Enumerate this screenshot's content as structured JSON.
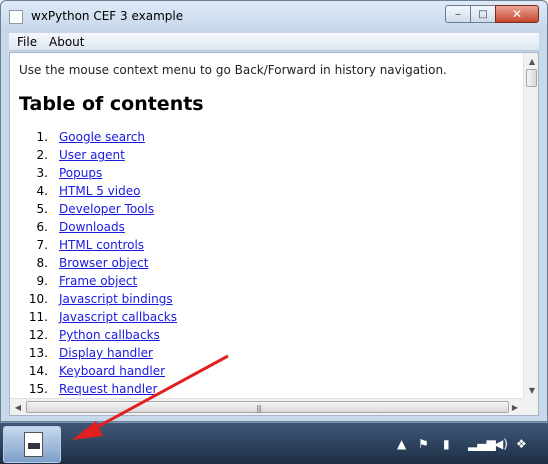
{
  "window": {
    "title": "wxPython CEF 3 example",
    "minimize_glyph": "‒",
    "maximize_glyph": "□",
    "close_glyph": "✕"
  },
  "menu": {
    "items": [
      {
        "label": "File"
      },
      {
        "label": "About"
      }
    ]
  },
  "page": {
    "intro": "Use the mouse context menu to go Back/Forward in history navigation.",
    "heading": "Table of contents",
    "toc": [
      {
        "num": "1.",
        "label": "Google search"
      },
      {
        "num": "2.",
        "label": "User agent"
      },
      {
        "num": "3.",
        "label": "Popups"
      },
      {
        "num": "4.",
        "label": "HTML 5 video"
      },
      {
        "num": "5.",
        "label": "Developer Tools"
      },
      {
        "num": "6.",
        "label": "Downloads"
      },
      {
        "num": "7.",
        "label": "HTML controls"
      },
      {
        "num": "8.",
        "label": "Browser object"
      },
      {
        "num": "9.",
        "label": "Frame object"
      },
      {
        "num": "10.",
        "label": "Javascript bindings"
      },
      {
        "num": "11.",
        "label": "Javascript callbacks"
      },
      {
        "num": "12.",
        "label": "Python callbacks"
      },
      {
        "num": "13.",
        "label": "Display handler"
      },
      {
        "num": "14.",
        "label": "Keyboard handler"
      },
      {
        "num": "15.",
        "label": "Request handler"
      }
    ]
  },
  "taskbar": {
    "tray_icons": [
      "chevron-up-icon",
      "flag-icon",
      "power-icon",
      "network-icon",
      "volume-icon",
      "dropbox-icon"
    ]
  },
  "colors": {
    "link": "#1a1ae0",
    "annotation_arrow": "#e02020"
  }
}
